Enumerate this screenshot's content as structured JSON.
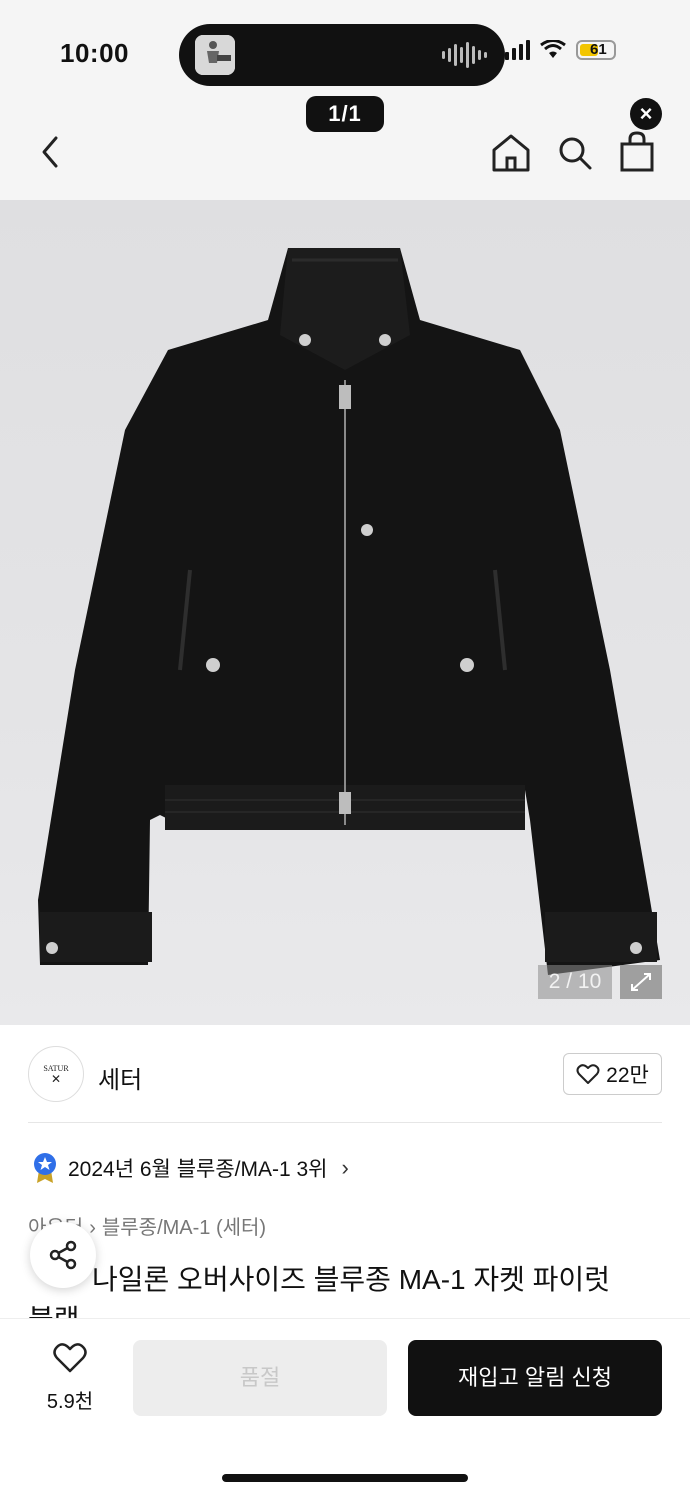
{
  "status_bar": {
    "time": "10:00",
    "battery": "61"
  },
  "viewer": {
    "page_indicator": "1/1",
    "close_label": "×"
  },
  "header": {
    "icons": [
      "back-icon",
      "home-icon",
      "search-icon",
      "bag-icon"
    ]
  },
  "product_image": {
    "counter": "2 / 10",
    "background": "#e2e2e4",
    "jacket_color": "#141414"
  },
  "brand": {
    "logo_text": "SATUR",
    "logo_mark": "✕",
    "name": "세터",
    "likes": "22만"
  },
  "ranking": {
    "text": "2024년 6월 블루종/MA-1 3위",
    "chevron": "›"
  },
  "breadcrumb": {
    "items": [
      "아우터",
      "블루종/MA-1 (세터)"
    ],
    "separator": "›"
  },
  "product": {
    "title_line1": "나일론 오버사이즈 블루종 MA-1 자켓 파이럿",
    "title_line2": "블랙"
  },
  "actions": {
    "wish_count": "5.9천",
    "soldout_label": "품절",
    "restock_label": "재입고 알림 신청"
  },
  "colors": {
    "accent_black": "#111111",
    "disabled_bg": "#ededed",
    "ranking_badge": "#2f6fe8"
  }
}
